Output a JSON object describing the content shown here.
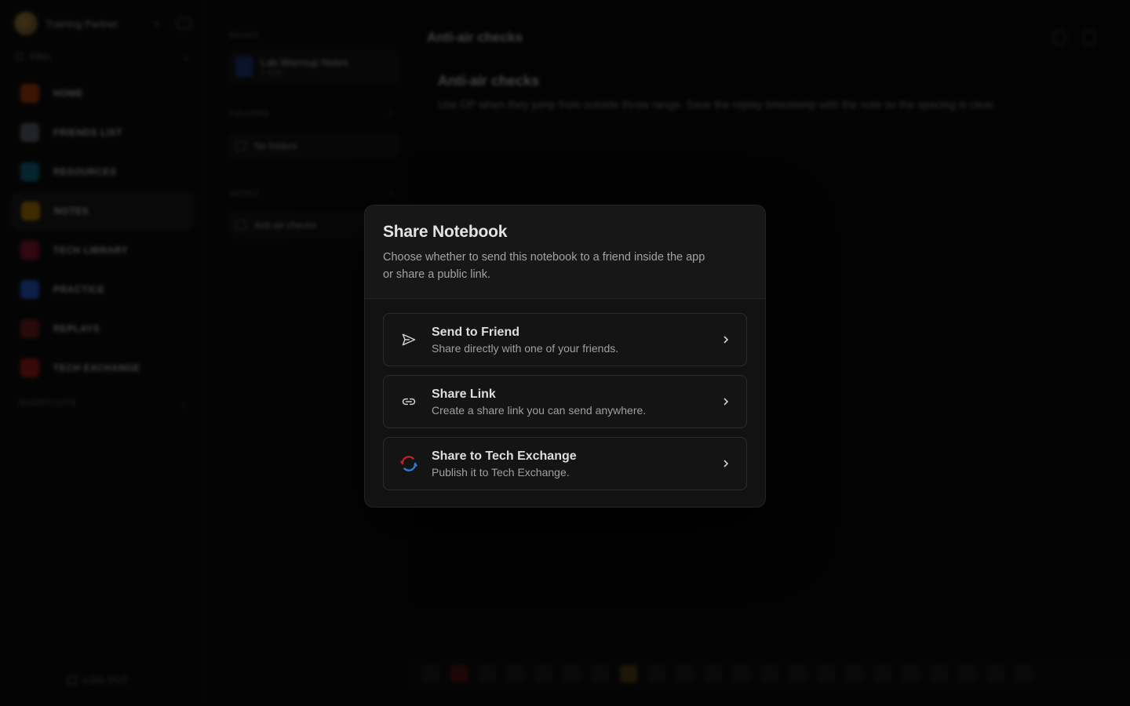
{
  "sidebar": {
    "profile_name": "Training Partner",
    "filter_label": "Filter",
    "nav_items": [
      {
        "label": "HOME",
        "color": "#c2410c"
      },
      {
        "label": "FRIENDS LIST",
        "color": "#6b7280"
      },
      {
        "label": "RESOURCES",
        "color": "#0e7490"
      },
      {
        "label": "NOTES",
        "color": "#ca8a04"
      },
      {
        "label": "TECH LIBRARY",
        "color": "#9f1239"
      },
      {
        "label": "PRACTICE",
        "color": "#2563eb"
      },
      {
        "label": "REPLAYS",
        "color": "#7f1d1d"
      },
      {
        "label": "TECH EXCHANGE",
        "color": "#b91c1c"
      }
    ],
    "section_label": "SHORTCUTS",
    "logout_label": "LOG OUT"
  },
  "notes_panel": {
    "notebooks_label": "BOOKS",
    "notebook_title": "Lab Warmup Notes",
    "notebook_sub": "1 note",
    "folders_label": "FOLDERS",
    "folder_empty": "No folders",
    "notes_label": "NOTES",
    "note_title": "Anti-air checks"
  },
  "editor": {
    "title": "Anti-air checks",
    "heading": "Anti-air checks",
    "body": "Use DP when they jump from outside throw range. Save the replay timestamp with the note so the spacing is clear."
  },
  "modal": {
    "title": "Share Notebook",
    "description": "Choose whether to send this notebook to a friend inside the app or share a public link.",
    "options": [
      {
        "title": "Send to Friend",
        "subtitle": "Share directly with one of your friends.",
        "icon": "send-icon"
      },
      {
        "title": "Share Link",
        "subtitle": "Create a share link you can send anywhere.",
        "icon": "link-icon"
      },
      {
        "title": "Share to Tech Exchange",
        "subtitle": "Publish it to Tech Exchange.",
        "icon": "tech-exchange-icon"
      }
    ]
  }
}
